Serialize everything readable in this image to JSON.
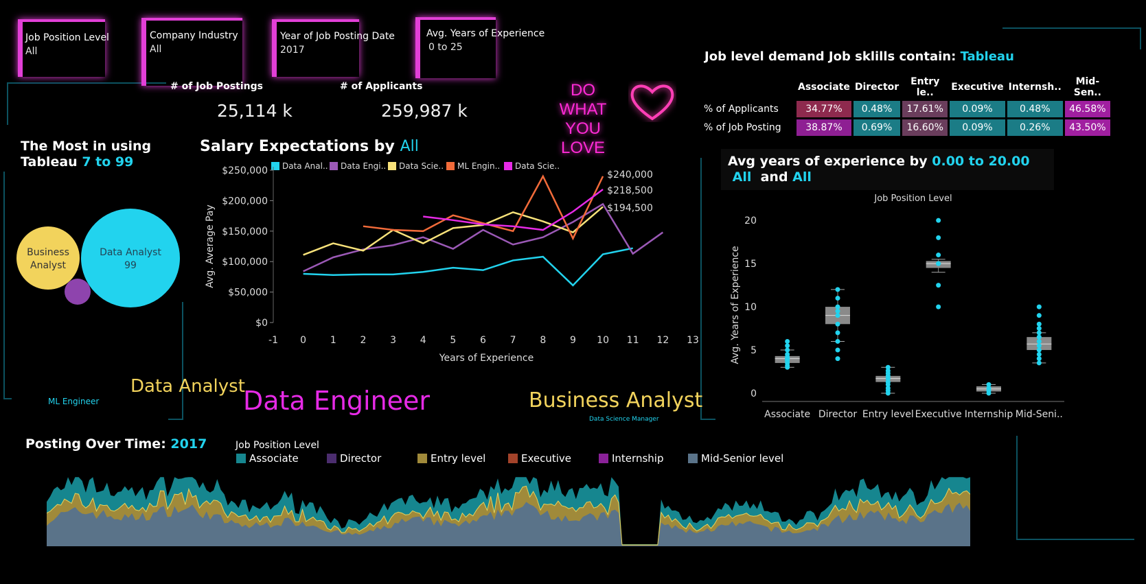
{
  "filters": [
    {
      "label": "Job Position Level",
      "value": "All"
    },
    {
      "label": "Company Industry",
      "value": "All"
    },
    {
      "label": "Year of Job Posting Date",
      "value": "2017"
    },
    {
      "label": "Avg. Years of Experience",
      "value": "0 to 25"
    }
  ],
  "kpis": {
    "postings_label": "# of  Job Postings",
    "postings_value": "25,114 k",
    "applicants_label": "# of Applicants",
    "applicants_value": "259,987 k"
  },
  "neon_sign": {
    "line1": "DO WHAT",
    "line2": "YOU LOVE"
  },
  "demand": {
    "title_prefix": "Job level demand Job sklills contain:",
    "title_skill": "Tableau",
    "columns": [
      "Associate",
      "Director",
      "Entry le..",
      "Executive",
      "Internsh..",
      "Mid-Sen.."
    ],
    "rows": [
      {
        "label": "% of Applicants",
        "values": [
          "34.77%",
          "0.48%",
          "17.61%",
          "0.09%",
          "0.48%",
          "46.58%"
        ],
        "colors": [
          "#8e2a4e",
          "#1b7c86",
          "#6a3d5c",
          "#1b7c86",
          "#1b7c86",
          "#a01fa0"
        ]
      },
      {
        "label": "% of Job Posting",
        "values": [
          "38.87%",
          "0.69%",
          "16.60%",
          "0.09%",
          "0.26%",
          "43.50%"
        ],
        "colors": [
          "#8e1f93",
          "#1b7c86",
          "#6a3d5c",
          "#1b7c86",
          "#1b7c86",
          "#a01fa0"
        ]
      }
    ]
  },
  "bubble": {
    "title_line1": "The Most in using",
    "title_line2": "Tableau",
    "range": "7 to 99",
    "bubbles": [
      {
        "name": "Business Analyst",
        "line1": "Business",
        "line2": "Analyst",
        "color": "#f2d35c"
      },
      {
        "name": "Data Analyst",
        "line1": "Data Analyst",
        "line2": "99",
        "color": "#22d3ee"
      },
      {
        "name": "Data Engineer",
        "line1": "",
        "line2": "",
        "color": "#8e44ad"
      }
    ]
  },
  "salary": {
    "title_prefix": "Salary Expectations by",
    "title_value": "All",
    "legend": [
      "Data Anal..",
      "Data Engi..",
      "Data Scie..",
      "ML Engin..",
      "Data Scie.."
    ],
    "end_labels": [
      "$240,000",
      "$218,500",
      "$194,500"
    ]
  },
  "words": {
    "data_analyst": "Data Analyst",
    "data_engineer": "Data Engineer",
    "business_analyst": "Business Analyst",
    "ml_engineer": "ML Engineer",
    "ds_manager": "Data Science Manager"
  },
  "experience": {
    "title_prefix": "Avg years of experience by",
    "title_range": "0.00 to 20.00",
    "title_all1": "All",
    "title_and": "and",
    "title_all2": "All",
    "header": "Job Position Level"
  },
  "posting": {
    "title_prefix": "Posting Over Time:",
    "title_year": "2017",
    "legend_title": "Job Position Level",
    "legend": [
      {
        "name": "Associate",
        "color": "#16868f"
      },
      {
        "name": "Director",
        "color": "#4b2d6e"
      },
      {
        "name": "Entry level",
        "color": "#a08a3a"
      },
      {
        "name": "Executive",
        "color": "#a3432a"
      },
      {
        "name": "Internship",
        "color": "#8a2198"
      },
      {
        "name": "Mid-Senior level",
        "color": "#5a7389"
      }
    ]
  },
  "chart_data": [
    {
      "type": "line",
      "title": "Salary Expectations by All",
      "xlabel": "Years of Experience",
      "ylabel": "Avg. Average Pay",
      "xlim": [
        -1,
        13
      ],
      "ylim": [
        0,
        250000
      ],
      "x_ticks": [
        "-1",
        "0",
        "1",
        "2",
        "3",
        "4",
        "5",
        "6",
        "7",
        "8",
        "9",
        "10",
        "11",
        "12",
        "13"
      ],
      "y_ticks": [
        "$0",
        "$50,000",
        "$100,000",
        "$150,000",
        "$200,000",
        "$250,000"
      ],
      "series": [
        {
          "name": "Data Anal..",
          "color": "#22d3ee",
          "x": [
            0,
            1,
            2,
            3,
            4,
            5,
            6,
            7,
            8,
            9,
            10,
            11
          ],
          "values": [
            80000,
            78000,
            79000,
            79000,
            83000,
            90000,
            86000,
            102000,
            108000,
            61000,
            112000,
            122000
          ]
        },
        {
          "name": "Data Engi..",
          "color": "#9b59b6",
          "x": [
            0,
            1,
            2,
            3,
            4,
            5,
            6,
            7,
            8,
            9,
            10,
            11,
            12
          ],
          "values": [
            84000,
            107000,
            120000,
            127000,
            140000,
            121000,
            152000,
            128000,
            140000,
            165000,
            194500,
            113000,
            148000
          ]
        },
        {
          "name": "Data Scie..",
          "color": "#f8e27a",
          "x": [
            0,
            1,
            2,
            3,
            4,
            5,
            6,
            7,
            8,
            9,
            10
          ],
          "values": [
            111000,
            130000,
            118000,
            152000,
            130000,
            155000,
            160000,
            181000,
            166000,
            148000,
            190000
          ]
        },
        {
          "name": "ML Engin..",
          "color": "#f26b3a",
          "x": [
            2,
            3,
            4,
            5,
            6,
            7,
            8,
            9,
            10
          ],
          "values": [
            158000,
            152000,
            150000,
            176000,
            163000,
            150000,
            240000,
            138000,
            240000
          ]
        },
        {
          "name": "Data Scie..",
          "color": "#e62ae6",
          "x": [
            4,
            5,
            6,
            7,
            8,
            9,
            10
          ],
          "values": [
            174000,
            168000,
            161000,
            158000,
            152000,
            182000,
            218500
          ]
        }
      ]
    },
    {
      "type": "scatter",
      "title": "Avg years of experience by 0.00 to 20.00 All and All",
      "xlabel": "Job Position Level",
      "ylabel": "Avg. Years of Experience",
      "ylim": [
        0,
        22
      ],
      "y_ticks": [
        "0",
        "5",
        "10",
        "15",
        "20"
      ],
      "categories": [
        "Associate",
        "Director",
        "Entry level",
        "Executive",
        "Internship",
        "Mid-Seni.."
      ],
      "boxes": [
        {
          "q1": 3.5,
          "median": 4,
          "q3": 4.3,
          "min": 3,
          "max": 5,
          "points": [
            3,
            3.2,
            3.5,
            3.8,
            4,
            4,
            4.2,
            4.5,
            5,
            5.5,
            6
          ]
        },
        {
          "q1": 8,
          "median": 9,
          "q3": 10,
          "min": 6,
          "max": 12,
          "points": [
            4,
            5,
            6,
            7,
            8,
            9,
            9.5,
            10,
            11,
            12
          ]
        },
        {
          "q1": 1.3,
          "median": 1.7,
          "q3": 2,
          "min": 0,
          "max": 3,
          "points": [
            0,
            0.3,
            0.6,
            1,
            1.3,
            1.7,
            2,
            2.3,
            2.6,
            3
          ]
        },
        {
          "q1": 14.5,
          "median": 15,
          "q3": 15.3,
          "min": 14,
          "max": 15.5,
          "points": [
            10,
            12.5,
            15,
            15,
            16,
            18,
            20
          ]
        },
        {
          "q1": 0.2,
          "median": 0.5,
          "q3": 0.8,
          "min": 0,
          "max": 1,
          "points": [
            0,
            0.3,
            0.6,
            1
          ]
        },
        {
          "q1": 5,
          "median": 5.7,
          "q3": 6.5,
          "min": 3.5,
          "max": 7,
          "points": [
            3.5,
            4,
            4.5,
            5,
            5.5,
            6,
            6.5,
            7,
            7.5,
            8,
            9,
            10
          ]
        }
      ]
    }
  ]
}
